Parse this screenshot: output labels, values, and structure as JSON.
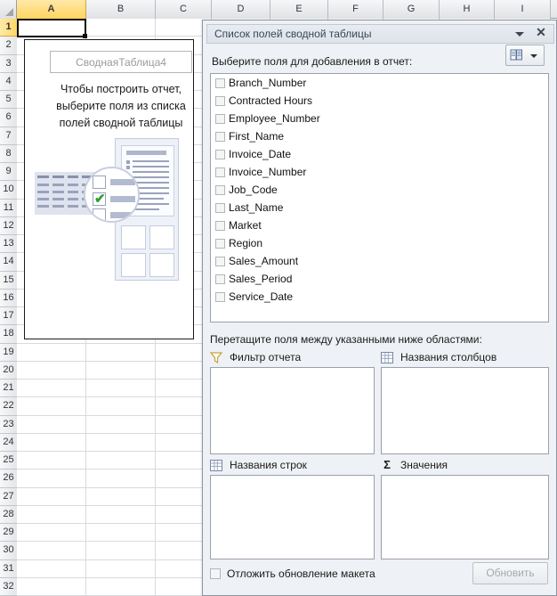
{
  "spreadsheet": {
    "columns": [
      "A",
      "B",
      "C",
      "D",
      "E",
      "F",
      "G",
      "H",
      "I"
    ],
    "selected_column": "A",
    "rows": [
      "1",
      "2",
      "3",
      "4",
      "5",
      "6",
      "7",
      "8",
      "9",
      "10",
      "11",
      "12",
      "13",
      "14",
      "15",
      "16",
      "17",
      "18",
      "19",
      "20",
      "21",
      "22",
      "23",
      "24",
      "25",
      "26",
      "27",
      "28",
      "29",
      "30",
      "31",
      "32"
    ],
    "selected_row": "1",
    "active_cell": "A1",
    "active_cell_value": ""
  },
  "pivot_placeholder": {
    "name": "СводнаяТаблица4",
    "message": "Чтобы построить отчет, выберите поля из списка полей сводной таблицы",
    "message_lines": [
      "Чтобы построить отчет,",
      "выберите поля из списка",
      "полей сводной таблицы"
    ]
  },
  "panel": {
    "title": "Список полей сводной таблицы",
    "collapse_icon": "chevron-down-icon",
    "close_icon": "close-icon",
    "subtitle": "Выберите поля для добавления в отчет:",
    "layout_button_icon": "field-list-layout-icon",
    "fields": [
      {
        "label": "Branch_Number",
        "checked": false
      },
      {
        "label": "Contracted Hours",
        "checked": false
      },
      {
        "label": "Employee_Number",
        "checked": false
      },
      {
        "label": "First_Name",
        "checked": false
      },
      {
        "label": "Invoice_Date",
        "checked": false
      },
      {
        "label": "Invoice_Number",
        "checked": false
      },
      {
        "label": "Job_Code",
        "checked": false
      },
      {
        "label": "Last_Name",
        "checked": false
      },
      {
        "label": "Market",
        "checked": false
      },
      {
        "label": "Region",
        "checked": false
      },
      {
        "label": "Sales_Amount",
        "checked": false
      },
      {
        "label": "Sales_Period",
        "checked": false
      },
      {
        "label": "Service_Date",
        "checked": false
      }
    ],
    "zones_instruction": "Перетащите поля между указанными ниже областями:",
    "zones": [
      {
        "label": "Фильтр отчета",
        "icon": "filter-icon",
        "items": []
      },
      {
        "label": "Названия столбцов",
        "icon": "grid-columns-icon",
        "items": []
      },
      {
        "label": "Названия строк",
        "icon": "grid-rows-icon",
        "items": []
      },
      {
        "label": "Значения",
        "icon": "sigma-icon",
        "items": []
      }
    ],
    "defer_label": "Отложить обновление макета",
    "defer_checked": false,
    "update_button": "Обновить",
    "update_enabled": false
  },
  "colors": {
    "header_selected": "#ffd45e",
    "panel_bg": "#eef1f5",
    "grid_line": "#d7dade",
    "check_green": "#2f9e2f"
  }
}
